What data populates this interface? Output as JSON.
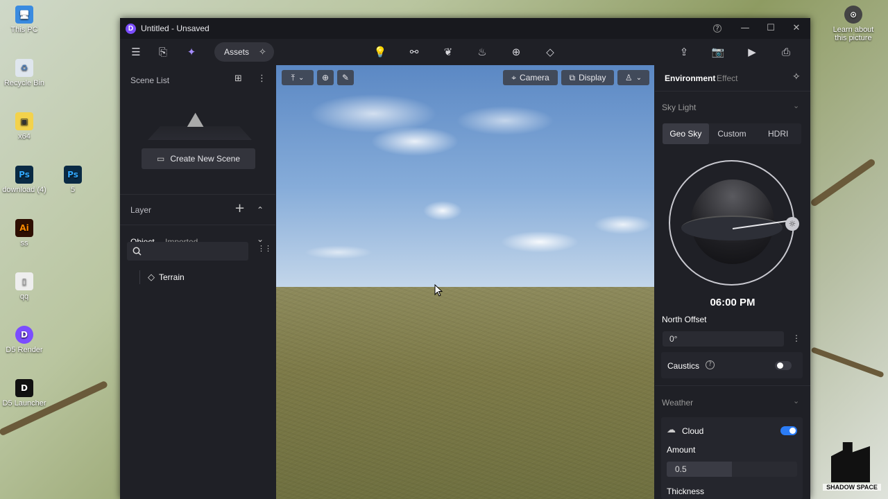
{
  "desktop": {
    "icons": [
      {
        "label": "This PC",
        "glyph": "🖥"
      },
      {
        "label": "Recycle Bin",
        "glyph": "♻"
      },
      {
        "label": "x64",
        "glyph": "▣"
      },
      {
        "label": "download (4)",
        "glyph": "Ps"
      },
      {
        "label": "5",
        "glyph": "Ps"
      },
      {
        "label": "ss",
        "glyph": "Ai"
      },
      {
        "label": "qq",
        "glyph": "▯"
      },
      {
        "label": "D5 Render",
        "glyph": "D"
      },
      {
        "label": "D5 Launcher",
        "glyph": "D"
      },
      {
        "label": "Learn about this picture",
        "glyph": "⊙"
      }
    ],
    "watermark": "SHADOW SPACE"
  },
  "window": {
    "title": "Untitled - Unsaved",
    "logo": "D",
    "help": "?",
    "minimize": "—",
    "maximize": "☐",
    "close": "✕"
  },
  "toolbar": {
    "menu_icon": "☰",
    "file_icon": "⎘",
    "ai_icon": "✦",
    "assets_label": "Assets",
    "assets_spark": "✧",
    "center_icons": [
      "💡",
      "⚯",
      "❦",
      "♨",
      "⊕",
      "◇"
    ],
    "right_icons": [
      "⇪",
      "📷",
      "▶",
      "⎙"
    ]
  },
  "scene": {
    "header": "Scene List",
    "add_icon": "⊞",
    "more_icon": "⋮",
    "placeholder_icon": "⛰",
    "create_label": "Create New Scene",
    "create_icon": "▭"
  },
  "layer": {
    "header": "Layer",
    "add": "+",
    "collapse": "⌃"
  },
  "objects": {
    "tab_object": "Object",
    "tab_imported": "Imported",
    "filter_icon": "⌄",
    "search_placeholder": "",
    "grid_icon": "⋮⋮",
    "items": [
      {
        "label": "Terrain",
        "icon": "◇"
      }
    ]
  },
  "viewport": {
    "camera_label": "Camera",
    "display_label": "Display",
    "camera_icon": "⌖",
    "display_icon": "⧉",
    "move_icon": "⤒",
    "globe_icon": "⊕",
    "pen_icon": "✎",
    "walk_icon": "♙",
    "caret": "⌄"
  },
  "environment": {
    "tab_environment": "Environment",
    "tab_effect": "Effect",
    "spark": "✧",
    "sky_light": "Sky Light",
    "chevron": "⌄",
    "modes": [
      "Geo Sky",
      "Custom",
      "HDRI"
    ],
    "active_mode": "Geo Sky",
    "sun_icon": "☼",
    "time": "06:00 PM",
    "north_offset_label": "North Offset",
    "north_offset_value": "0°",
    "more": "⋮",
    "caustics_label": "Caustics",
    "caustics_help": "?",
    "caustics_on": false,
    "weather_label": "Weather",
    "cloud_label": "Cloud",
    "cloud_icon": "☁",
    "cloud_on": true,
    "amount_label": "Amount",
    "amount_value": "0.5",
    "amount_fraction": 0.5,
    "thickness_label": "Thickness"
  },
  "colors": {
    "accent": "#2b7cf6",
    "panel": "#1f2026",
    "purple": "#7b4dff"
  }
}
